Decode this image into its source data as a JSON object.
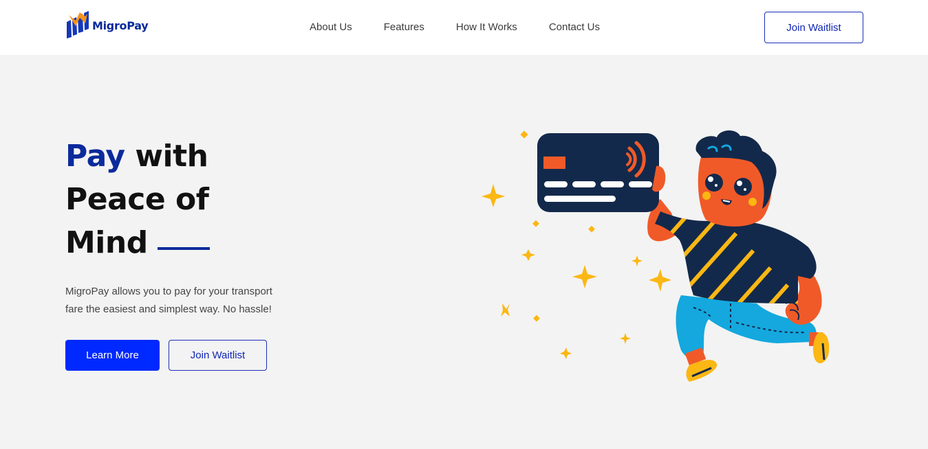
{
  "header": {
    "brand": "MigroPay",
    "nav": {
      "about": "About Us",
      "features": "Features",
      "how": "How It Works",
      "contact": "Contact Us"
    },
    "cta": "Join Waitlist"
  },
  "hero": {
    "title_accent": "Pay",
    "title_rest": " with",
    "title_line2": "Peace of",
    "title_line3": "Mind",
    "description": "MigroPay allows you to pay for your transport fare the easiest and simplest way. No hassle!",
    "primary_button": "Learn More",
    "secondary_button": "Join Waitlist"
  },
  "colors": {
    "brand_blue": "#0b2a9c",
    "primary_button": "#0029ff",
    "background": "#f3f3f3",
    "accent_orange": "#f05a28",
    "accent_yellow": "#fbb713"
  },
  "icons": {
    "logo": "migropay-logo-icon",
    "illustration": "person-holding-card-illustration"
  }
}
